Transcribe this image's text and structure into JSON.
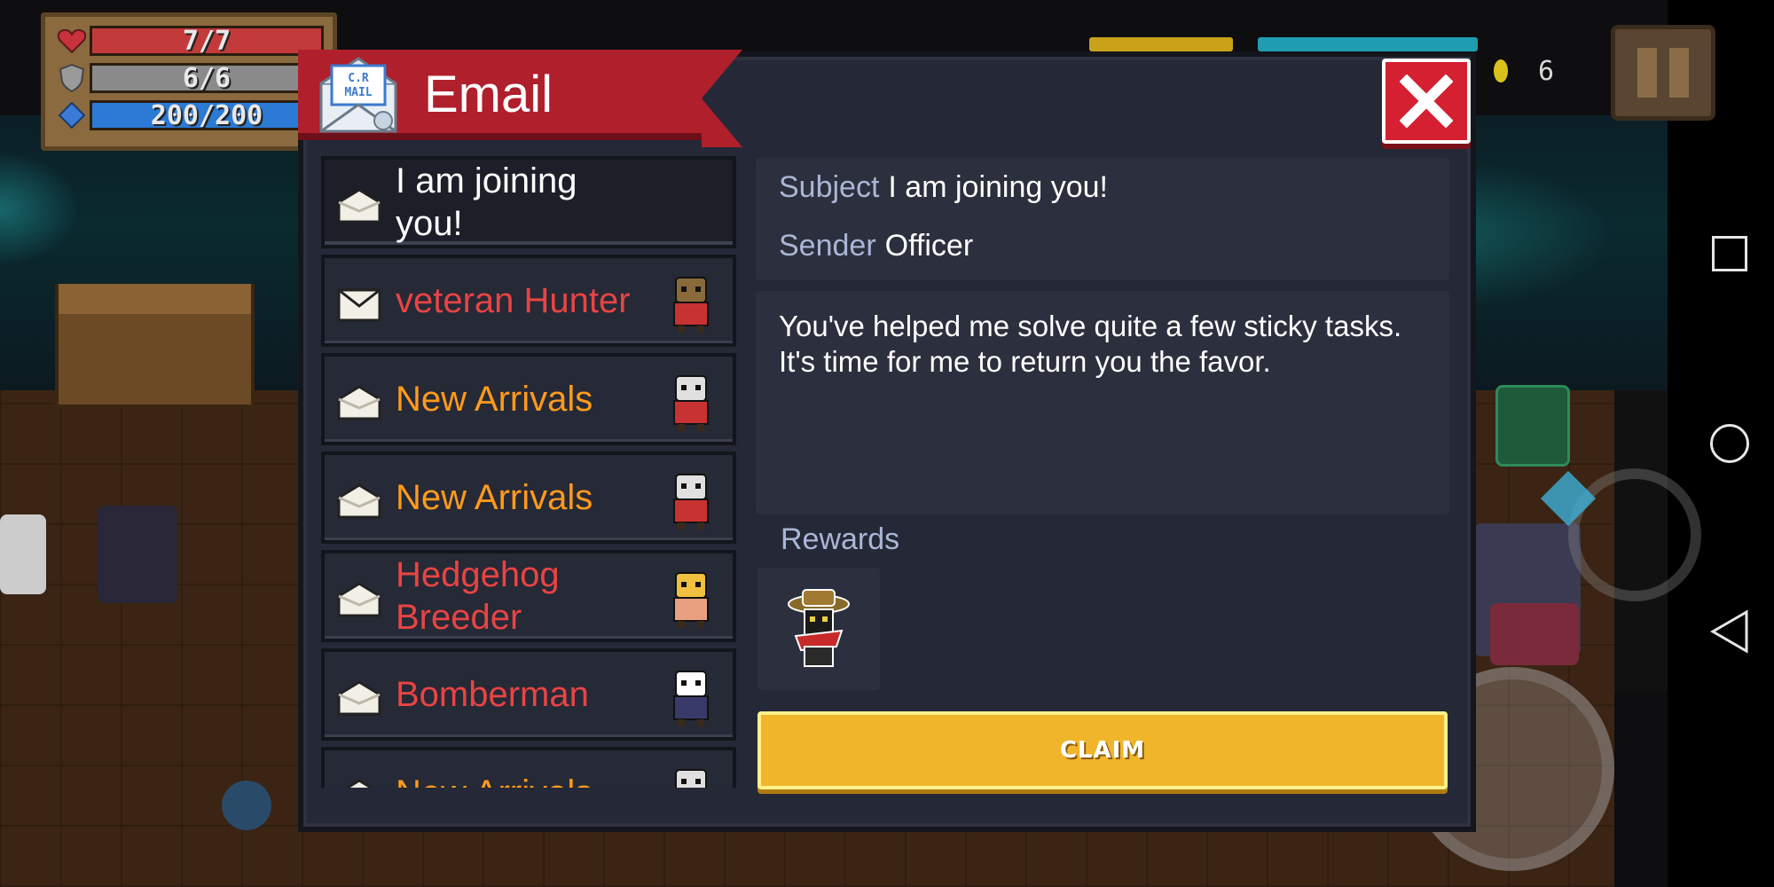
{
  "hud": {
    "health": "7/7",
    "armor": "6/6",
    "energy": "200/200",
    "health_fill": 1.0,
    "armor_fill": 1.0,
    "energy_fill": 1.0,
    "coins": "6"
  },
  "email": {
    "title": "Email",
    "logo_text": "C.R MAIL",
    "list": [
      {
        "label": "I am joining you!",
        "color": "#ffffff",
        "opened": true,
        "selected": true,
        "thumb": ""
      },
      {
        "label": "veteran Hunter",
        "color": "#e84444",
        "opened": false,
        "selected": false,
        "thumb": "hunter-icon"
      },
      {
        "label": "New Arrivals",
        "color": "#ff9a1e",
        "opened": true,
        "selected": false,
        "thumb": "cat-knight-icon"
      },
      {
        "label": "New Arrivals",
        "color": "#ff9a1e",
        "opened": true,
        "selected": false,
        "thumb": "cat-knight-icon"
      },
      {
        "label": "Hedgehog Breeder",
        "color": "#e84444",
        "opened": true,
        "selected": false,
        "thumb": "cupid-icon"
      },
      {
        "label": "Bomberman",
        "color": "#e84444",
        "opened": true,
        "selected": false,
        "thumb": "bomber-icon"
      },
      {
        "label": "New Arrivals",
        "color": "#ff9a1e",
        "opened": true,
        "selected": false,
        "thumb": "cat-knight-icon"
      }
    ],
    "detail": {
      "subject_key": "Subject",
      "subject": "I am joining you!",
      "sender_key": "Sender",
      "sender": "Officer",
      "body": "You've helped me solve quite a few sticky tasks. It's time for me to return you the favor.",
      "rewards_title": "Rewards",
      "reward_icon": "officer-character-icon",
      "claim_label": "CLAIM"
    }
  },
  "colors": {
    "header_red": "#b01f2c",
    "panel": "#252836",
    "claim": "#f0b52a",
    "label_key": "#aab6d6"
  }
}
